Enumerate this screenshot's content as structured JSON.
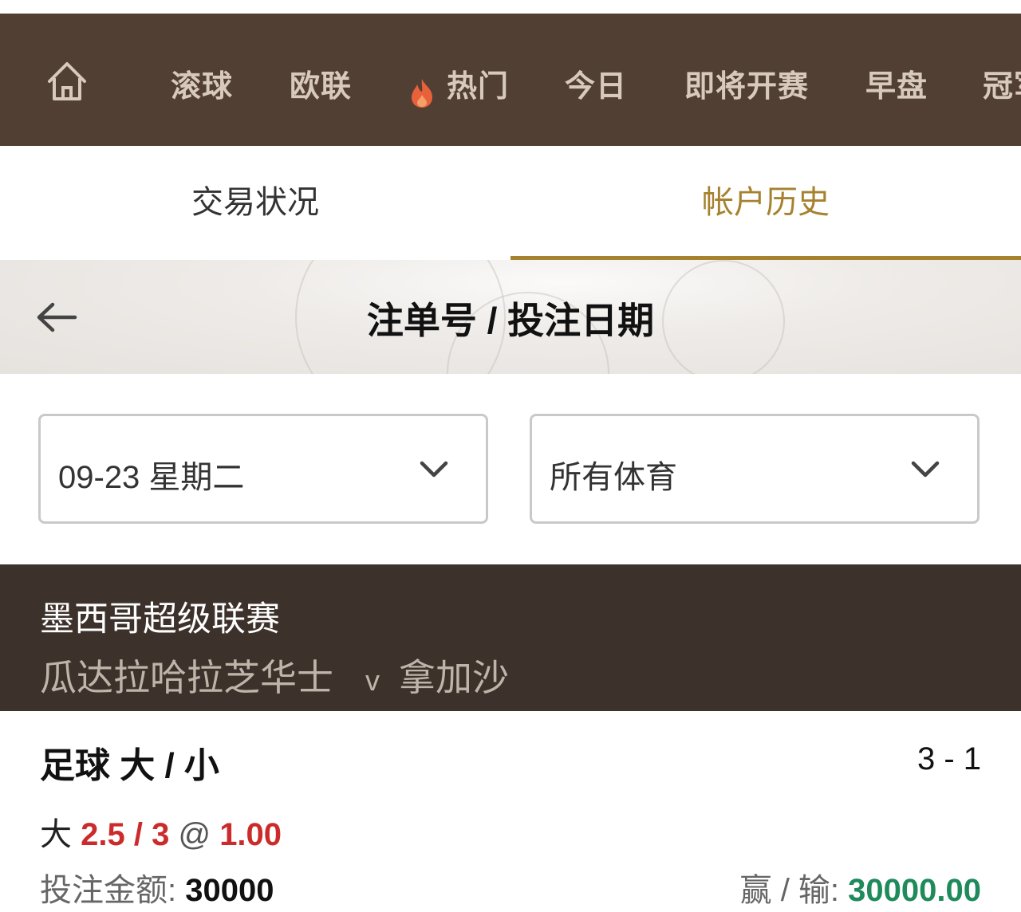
{
  "nav": {
    "items": [
      "滚球",
      "欧联",
      "热门",
      "今日",
      "即将开赛",
      "早盘",
      "冠军"
    ],
    "hot_label": "热门"
  },
  "subtabs": {
    "tab1": "交易状况",
    "tab2": "帐户历史"
  },
  "title_bar": {
    "title": "注单号 / 投注日期"
  },
  "filters": {
    "date": "09-23 星期二",
    "sport": "所有体育"
  },
  "league": {
    "name": "墨西哥超级联赛",
    "home": "瓜达拉哈拉芝华士",
    "vs": "v",
    "away": "拿加沙"
  },
  "bet": {
    "type": "足球 大 / 小",
    "score": "3 - 1",
    "pick_side": "大",
    "pick_line": "2.5 / 3",
    "pick_at": "@",
    "pick_odds": "1.00",
    "stake_label": "投注金额:",
    "stake_value": "30000",
    "winloss_label": "赢 / 输:",
    "winloss_value": "30000.00"
  },
  "colors": {
    "nav_bg": "#523f34",
    "accent_gold": "#a6822f",
    "league_bg": "#3d322b",
    "odds_red": "#cc2b2b",
    "win_green": "#1f8a5b"
  }
}
